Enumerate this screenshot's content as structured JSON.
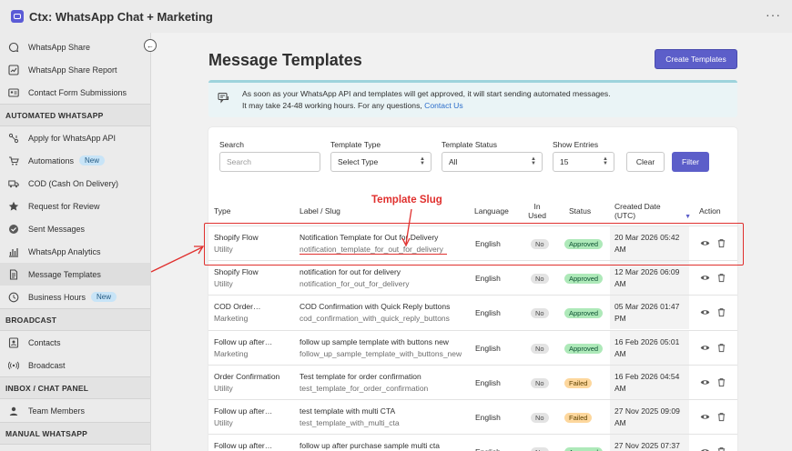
{
  "app": {
    "title": "Ctx: WhatsApp Chat + Marketing"
  },
  "sidebar": {
    "items_top": [
      {
        "label": "WhatsApp Share"
      },
      {
        "label": "WhatsApp Share Report"
      },
      {
        "label": "Contact Form Submissions"
      }
    ],
    "section_automated": "AUTOMATED WHATSAPP",
    "items_automated": [
      {
        "label": "Apply for WhatsApp API"
      },
      {
        "label": "Automations",
        "badge": "New"
      },
      {
        "label": "COD (Cash On Delivery)"
      },
      {
        "label": "Request for Review"
      },
      {
        "label": "Sent Messages"
      },
      {
        "label": "WhatsApp Analytics"
      },
      {
        "label": "Message Templates"
      },
      {
        "label": "Business Hours",
        "badge": "New"
      }
    ],
    "section_broadcast": "BROADCAST",
    "items_broadcast": [
      {
        "label": "Contacts"
      },
      {
        "label": "Broadcast"
      }
    ],
    "section_inbox": "INBOX / CHAT PANEL",
    "items_inbox": [
      {
        "label": "Team Members"
      }
    ],
    "section_manual": "MANUAL WHATSAPP"
  },
  "main": {
    "title": "Message Templates",
    "create_button": "Create Templates",
    "banner": {
      "line1": "As soon as your WhatsApp API and templates will get approved, it will start sending automated messages.",
      "line2": "It may take 24-48 working hours. For any questions, ",
      "link": "Contact Us"
    },
    "filters": {
      "search_label": "Search",
      "search_placeholder": "Search",
      "type_label": "Template Type",
      "type_value": "Select Type",
      "status_label": "Template Status",
      "status_value": "All",
      "entries_label": "Show Entries",
      "entries_value": "15",
      "clear": "Clear",
      "filter": "Filter"
    },
    "columns": {
      "type": "Type",
      "label": "Label / Slug",
      "language": "Language",
      "in_used_1": "In",
      "in_used_2": "Used",
      "status": "Status",
      "created_1": "Created Date",
      "created_2": "(UTC)",
      "action": "Action"
    },
    "rows": [
      {
        "type": "Shopify Flow",
        "category": "Utility",
        "label": "Notification Template for Out for Delivery",
        "slug": "notification_template_for_out_for_delivery",
        "language": "English",
        "in_used": "No",
        "status": "Approved",
        "date_1": "20 Mar 2026 05:42",
        "date_2": "AM"
      },
      {
        "type": "Shopify Flow",
        "category": "Utility",
        "label": "notification for out for delivery",
        "slug": "notification_for_out_for_delivery",
        "language": "English",
        "in_used": "No",
        "status": "Approved",
        "date_1": "12 Mar 2026 06:09",
        "date_2": "AM"
      },
      {
        "type": "COD Order…",
        "category": "Marketing",
        "label": "COD Confirmation with Quick Reply buttons",
        "slug": "cod_confirmation_with_quick_reply_buttons",
        "language": "English",
        "in_used": "No",
        "status": "Approved",
        "date_1": "05 Mar 2026 01:47",
        "date_2": "PM"
      },
      {
        "type": "Follow up after…",
        "category": "Marketing",
        "label": "follow up sample template with buttons new",
        "slug": "follow_up_sample_template_with_buttons_new",
        "language": "English",
        "in_used": "No",
        "status": "Approved",
        "date_1": "16 Feb 2026 05:01",
        "date_2": "AM"
      },
      {
        "type": "Order Confirmation",
        "category": "Utility",
        "label": "Test template for order confirmation",
        "slug": "test_template_for_order_confirmation",
        "language": "English",
        "in_used": "No",
        "status": "Failed",
        "date_1": "16 Feb 2026 04:54",
        "date_2": "AM"
      },
      {
        "type": "Follow up after…",
        "category": "Utility",
        "label": "test template with multi CTA",
        "slug": "test_template_with_multi_cta",
        "language": "English",
        "in_used": "No",
        "status": "Failed",
        "date_1": "27 Nov 2025 09:09",
        "date_2": "AM"
      },
      {
        "type": "Follow up after…",
        "category": "",
        "label": "follow up after purchase sample multi cta",
        "slug": "",
        "language": "English",
        "in_used": "No",
        "status": "Approved",
        "date_1": "27 Nov 2025 07:37",
        "date_2": ""
      }
    ]
  },
  "annotation": {
    "label": "Template Slug"
  },
  "colors": {
    "accent": "#5c5ec9",
    "annotation": "#e0302e",
    "approved_bg": "#aee9b9",
    "failed_bg": "#fdd79d"
  }
}
